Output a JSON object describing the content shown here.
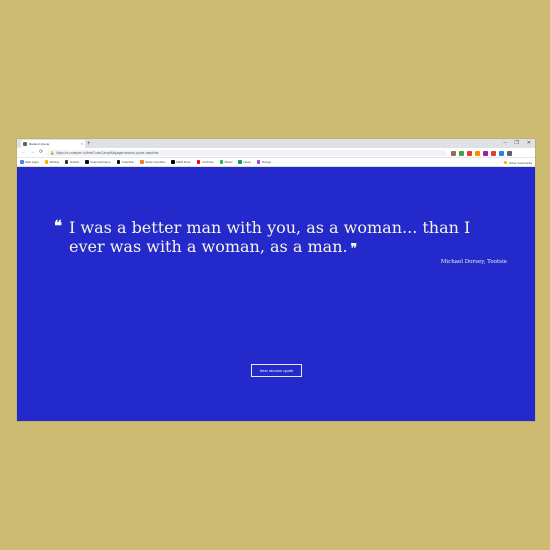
{
  "browser": {
    "tab_title": "Random Quote",
    "tab_close": "×",
    "new_tab": "+",
    "controls": {
      "minimize": "–",
      "maximize": "❐",
      "close": "✕"
    },
    "nav": {
      "back": "←",
      "forward": "→",
      "reload": "⟳"
    },
    "lock": "🔒",
    "url": "https://s.codepen.io/freeCodeCamp/fullpage/random-quote-machine",
    "extension_colors": [
      "#8d6e63",
      "#43a047",
      "#e53935",
      "#fb8c00",
      "#8e24aa",
      "#e53935",
      "#1e88e5",
      "#5f6368"
    ],
    "bookmarks": [
      {
        "label": "Web Apps",
        "color": "#4285f4"
      },
      {
        "label": "Writing",
        "color": "#f4b400"
      },
      {
        "label": "GitHub",
        "color": "#333333"
      },
      {
        "label": "freeCodeCamp",
        "color": "#0a0a23"
      },
      {
        "label": "CodePen",
        "color": "#111111"
      },
      {
        "label": "Stack Overflow",
        "color": "#f48024"
      },
      {
        "label": "MDN Docs",
        "color": "#000000"
      },
      {
        "label": "YouTube",
        "color": "#ff0000"
      },
      {
        "label": "Music",
        "color": "#1db954"
      },
      {
        "label": "News",
        "color": "#0f9d58"
      },
      {
        "label": "Design",
        "color": "#a142f4"
      }
    ],
    "other_bookmarks": "Other bookmarks"
  },
  "quote": {
    "open_mark": "❝",
    "text": "I was a better man with you, as a woman... than I ever was with a woman, as a man.",
    "close_mark": "❞",
    "author": "Michael Dorsey, Tootsie"
  },
  "button": {
    "label": "New random quote"
  },
  "colors": {
    "background": "#cdbb72",
    "page": "#2329cb",
    "text": "#f6f4e2"
  }
}
